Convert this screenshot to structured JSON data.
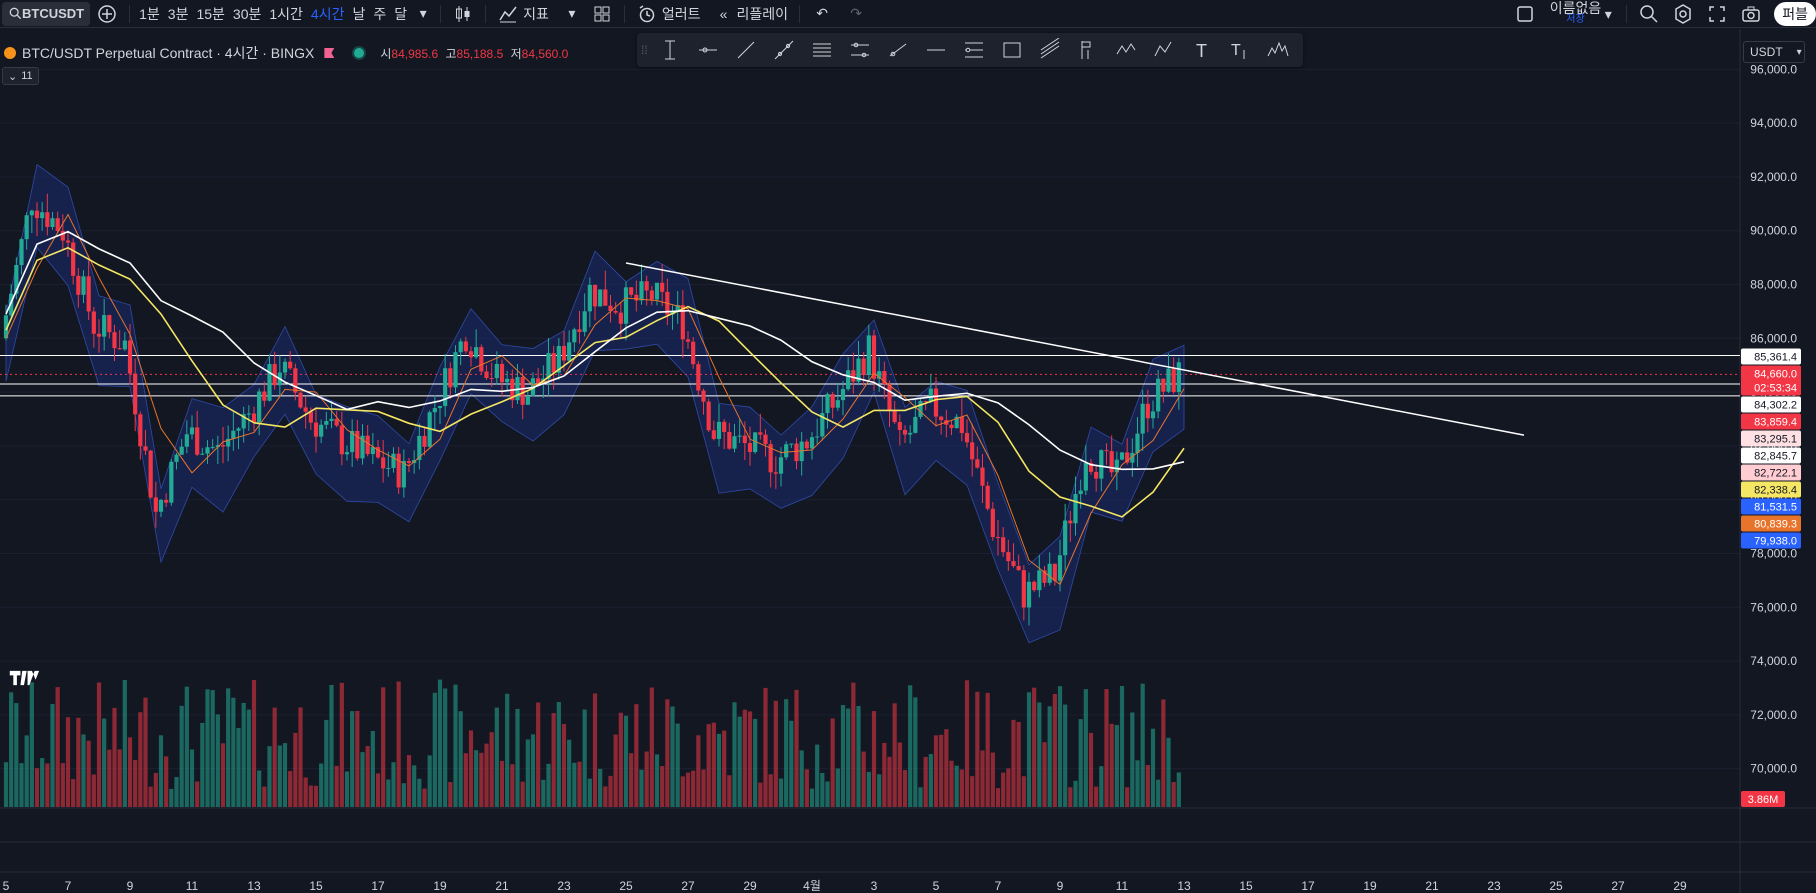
{
  "toolbar": {
    "symbol": "BTCUSDT",
    "intervals": [
      "1분",
      "3분",
      "15분",
      "30분",
      "1시간",
      "4시간",
      "날",
      "주",
      "달"
    ],
    "active_interval": "4시간",
    "indicators_label": "지표",
    "alert_label": "얼러트",
    "replay_label": "리플레이",
    "layout_name": "이름없음",
    "save_label": "저장",
    "publish_label": "퍼블"
  },
  "legend": {
    "title": "BTC/USDT Perpetual Contract · 4시간 · BINGX",
    "open_label": "시",
    "open": "84,985.6",
    "high_label": "고",
    "high": "85,188.5",
    "low_label": "저",
    "low": "84,560.0",
    "indicator_count": "11"
  },
  "currency": "USDT",
  "colors": {
    "up": "#22ab94",
    "down": "#f23645",
    "accent": "#2962ff",
    "cloud": "#1a2b6e",
    "ma_yellow": "#f5e663",
    "ma_white": "#ffffff",
    "ma_orange": "#e8742c"
  },
  "chart_data": {
    "type": "candlestick",
    "x_ticks": [
      "5",
      "7",
      "9",
      "11",
      "13",
      "15",
      "17",
      "19",
      "21",
      "23",
      "25",
      "27",
      "29",
      "4월",
      "3",
      "5",
      "7",
      "9",
      "11",
      "13",
      "15",
      "17",
      "19",
      "21",
      "23",
      "25",
      "27",
      "29"
    ],
    "y_ticks": [
      "96,000.0",
      "94,000.0",
      "92,000.0",
      "90,000.0",
      "88,000.0",
      "86,000.0",
      "84,000.0",
      "82,000.0",
      "80,000.0",
      "78,000.0",
      "76,000.0",
      "74,000.0",
      "72,000.0",
      "70,000.0"
    ],
    "ylim": [
      68500,
      97500
    ],
    "price_labels": [
      {
        "text": "85,361.4",
        "value": 85361.4,
        "bg": "#ffffff",
        "fg": "#131722"
      },
      {
        "text": "84,660.0",
        "value": 84660.0,
        "bg": "#f23645",
        "fg": "#ffffff",
        "sub": "02:53:34"
      },
      {
        "text": "84,302.2",
        "value": 84302.2,
        "bg": "#ffffff",
        "fg": "#131722"
      },
      {
        "text": "83,859.4",
        "value": 83859.4,
        "bg": "#f23645",
        "fg": "#ffffff"
      },
      {
        "text": "83,295.1",
        "value": 83295.1,
        "bg": "#ffe0e3",
        "fg": "#131722"
      },
      {
        "text": "82,845.7",
        "value": 82845.7,
        "bg": "#ffffff",
        "fg": "#131722"
      },
      {
        "text": "82,722.1",
        "value": 82722.1,
        "bg": "#ffcdd2",
        "fg": "#131722"
      },
      {
        "text": "82,338.4",
        "value": 82338.4,
        "bg": "#f5e663",
        "fg": "#131722"
      },
      {
        "text": "81,531.5",
        "value": 81531.5,
        "bg": "#2962ff",
        "fg": "#ffffff"
      },
      {
        "text": "80,839.3",
        "value": 80839.3,
        "bg": "#e8742c",
        "fg": "#ffffff"
      },
      {
        "text": "79,938.0",
        "value": 79938.0,
        "bg": "#2962ff",
        "fg": "#ffffff"
      }
    ],
    "volume_label": "3.86M",
    "horizontal_lines": [
      85361.4,
      84302.2,
      83859.4
    ],
    "trendline": {
      "from_tick": "25",
      "from_price": 88800,
      "to_tick": "23",
      "to_price": 82400
    },
    "close_path": [
      [
        "5",
        86000
      ],
      [
        "7",
        91200
      ],
      [
        "8",
        90000
      ],
      [
        "9",
        86500
      ],
      [
        "10",
        85800
      ],
      [
        "11",
        79500
      ],
      [
        "12",
        82500
      ],
      [
        "13",
        81800
      ],
      [
        "14",
        83200
      ],
      [
        "15",
        85000
      ],
      [
        "16",
        83000
      ],
      [
        "17",
        82200
      ],
      [
        "18",
        81500
      ],
      [
        "19",
        81000
      ],
      [
        "20",
        83500
      ],
      [
        "21",
        86200
      ],
      [
        "22",
        84500
      ],
      [
        "23",
        84000
      ],
      [
        "24",
        85200
      ],
      [
        "25",
        87800
      ],
      [
        "26",
        87200
      ],
      [
        "27",
        87600
      ],
      [
        "28",
        86600
      ],
      [
        "29",
        82500
      ],
      [
        "30",
        82000
      ],
      [
        "31",
        81500
      ],
      [
        "4월",
        82200
      ],
      [
        "2",
        83800
      ],
      [
        "3",
        85600
      ],
      [
        "4",
        82000
      ],
      [
        "5",
        83500
      ],
      [
        "6",
        82800
      ],
      [
        "7",
        79000
      ],
      [
        "8",
        76500
      ],
      [
        "9",
        77200
      ],
      [
        "10",
        81800
      ],
      [
        "11",
        80800
      ],
      [
        "12",
        83600
      ],
      [
        "13",
        84660
      ]
    ]
  }
}
